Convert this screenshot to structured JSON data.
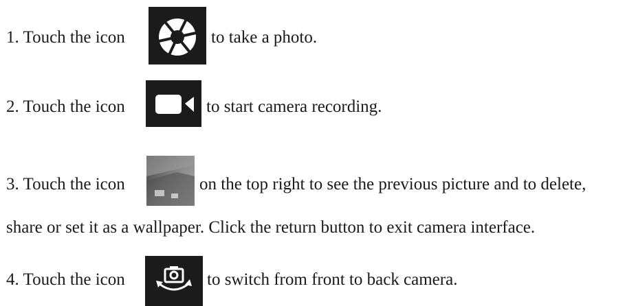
{
  "steps": [
    {
      "pre": "1. Touch the icon",
      "post": "to take a photo.",
      "icon": "shutter-icon"
    },
    {
      "pre": "2. Touch the icon",
      "post": "to start camera recording.",
      "icon": "video-camera-icon"
    },
    {
      "pre": "3. Touch the icon",
      "post": "on the top right to see the previous picture and to delete,",
      "post_line2": "share or set it as a wallpaper. Click the return button to exit camera interface.",
      "icon": "gallery-thumbnail-icon"
    },
    {
      "pre": "4. Touch the icon",
      "post": "to switch from front to back camera.",
      "icon": "switch-camera-icon"
    }
  ],
  "colors": {
    "icon_background": "#1b1b1b",
    "icon_foreground": "#ffffff",
    "text": "#1a1a1a"
  }
}
